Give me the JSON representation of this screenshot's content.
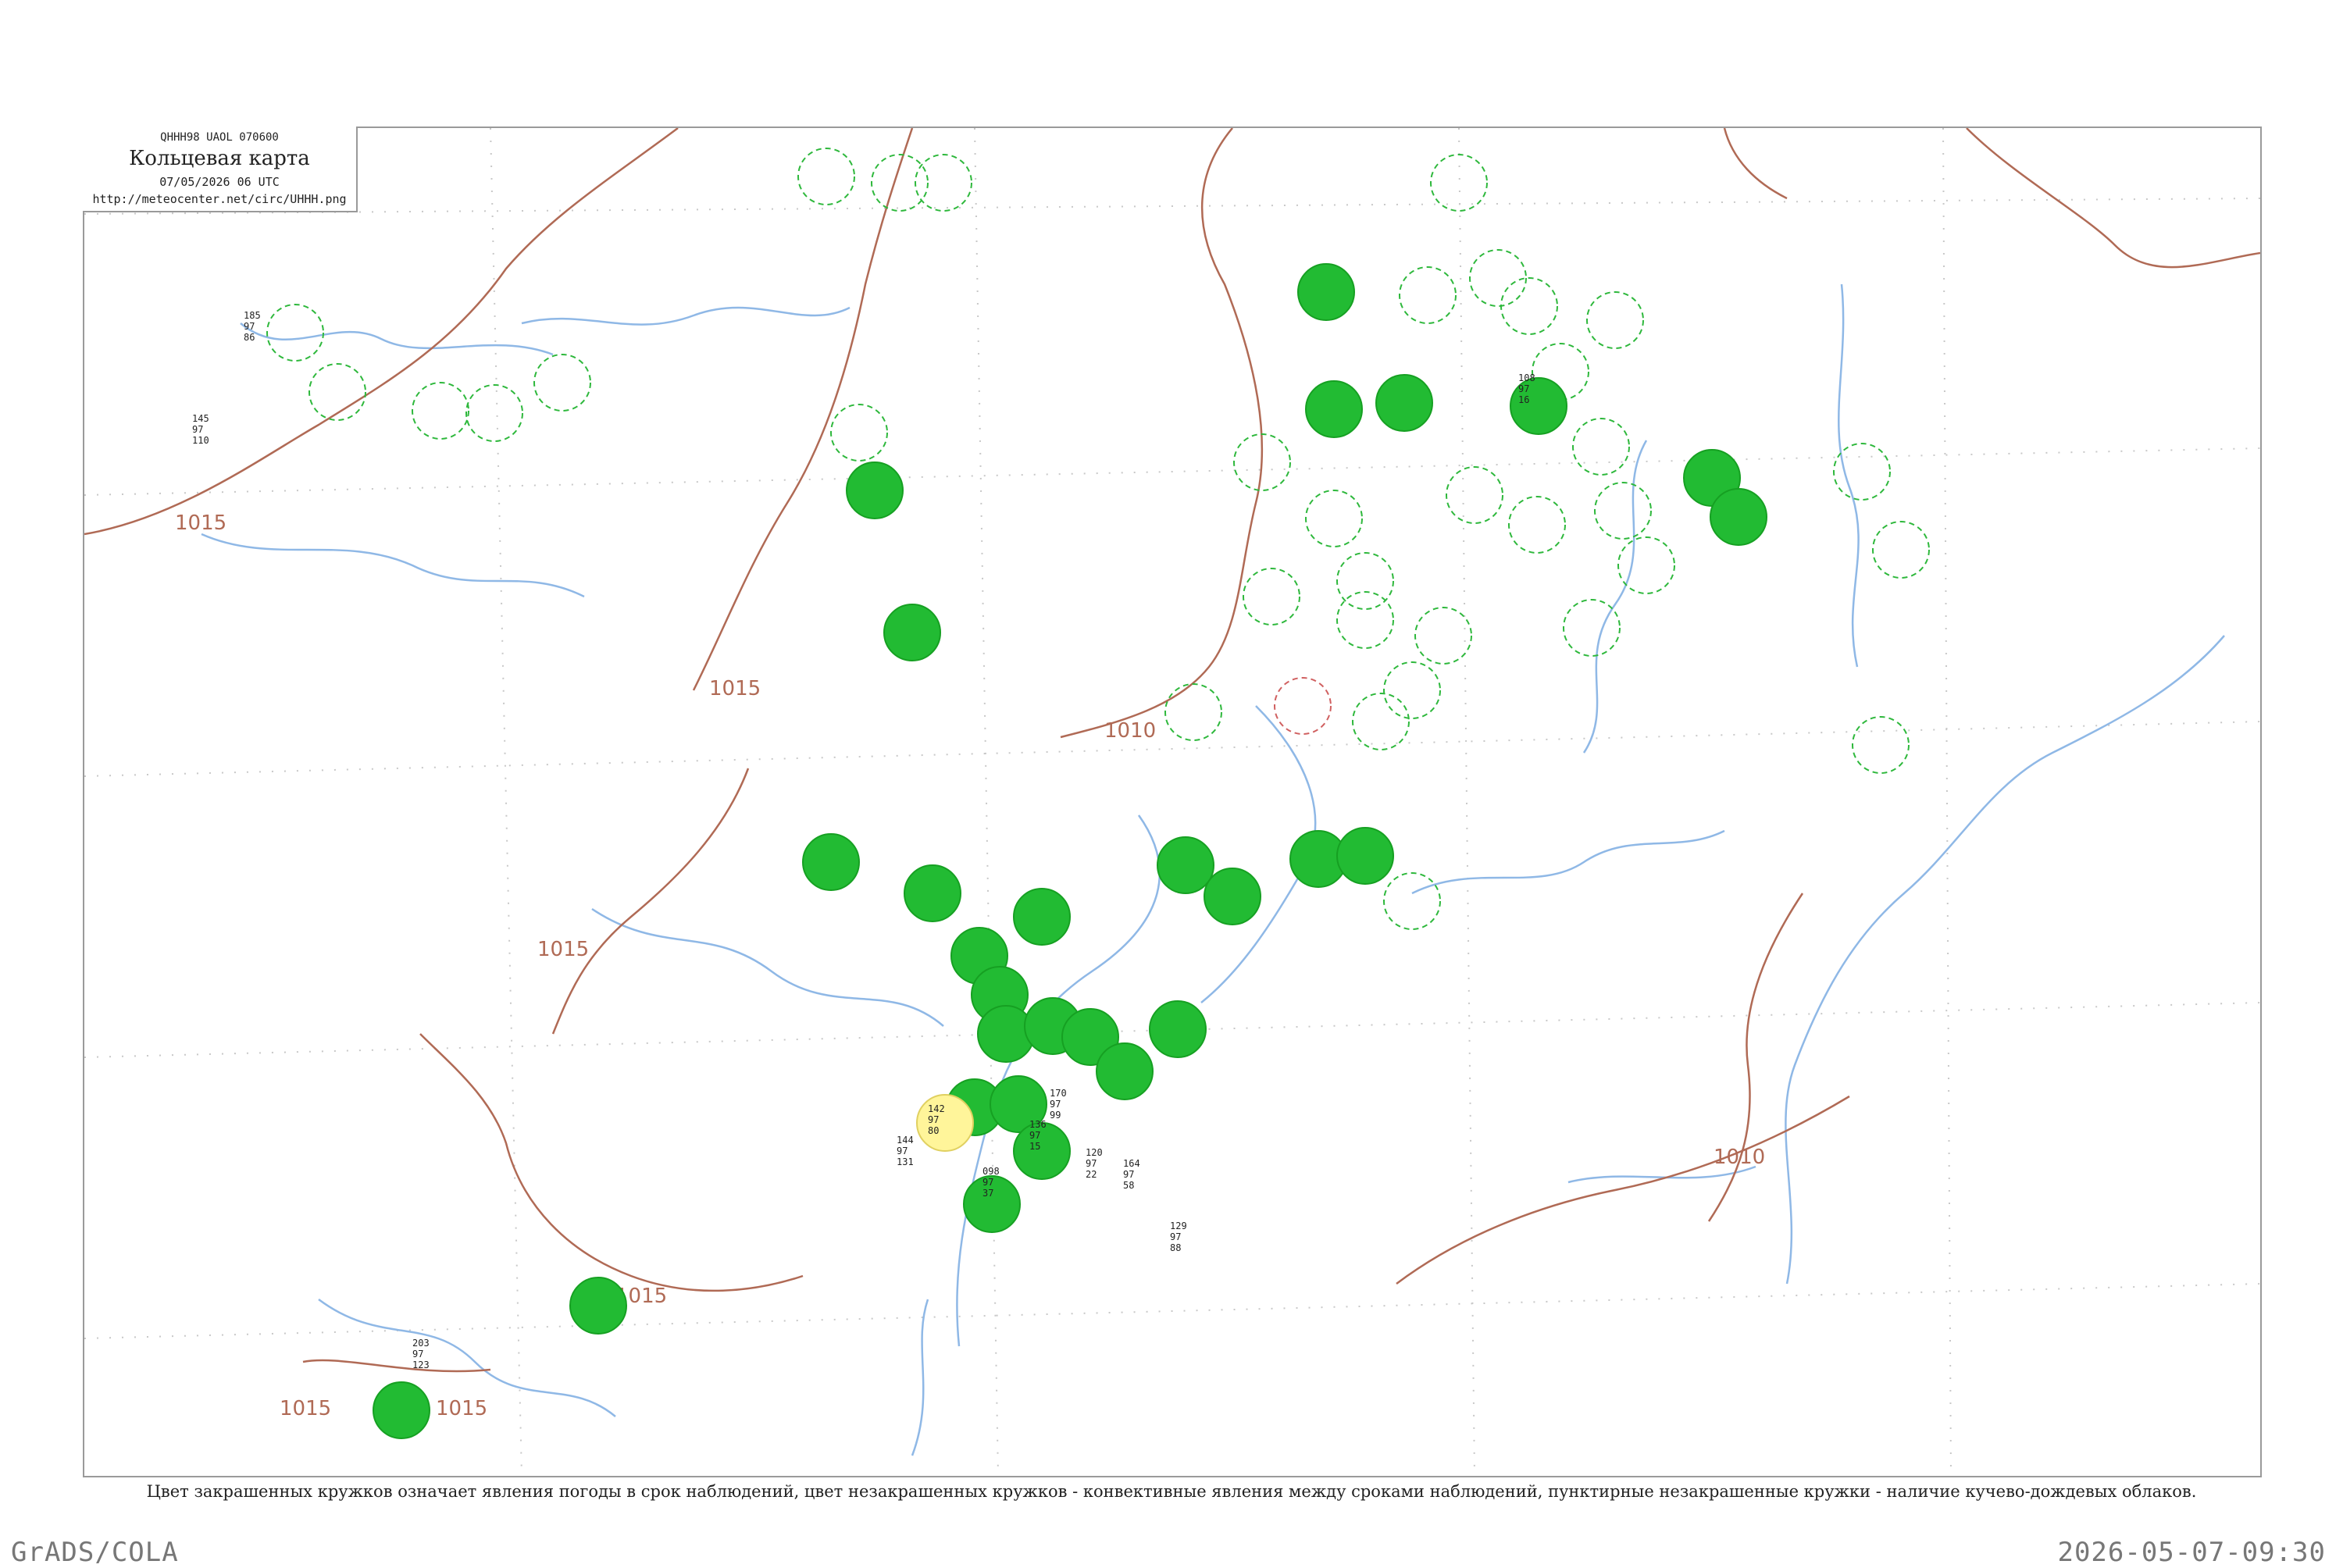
{
  "header": {
    "code": "QHHH98  UAOL  070600",
    "title": "Кольцевая карта",
    "time": "07/05/2026 06 UTC",
    "url": "http://meteocenter.net/circ/UHHH.png"
  },
  "caption": "Цвет закрашенных кружков означает явления погоды в срок наблюдений, цвет незакрашенных кружков - конвективные явления между сроками наблюдений, пунктирные незакрашенные кружки - наличие кучево-дождевых облаков.",
  "footer": {
    "left": "GrADS/COLA",
    "right": "2026-05-07-09:30"
  },
  "isobars": [
    {
      "label": "1015"
    },
    {
      "label": "1015"
    },
    {
      "label": "1010"
    },
    {
      "label": "1015"
    },
    {
      "label": "1015"
    },
    {
      "label": "1015"
    },
    {
      "label": "1015"
    },
    {
      "label": "1010"
    }
  ],
  "stations": [
    {
      "temp": "142",
      "p": "97",
      "d": "80"
    },
    {
      "temp": "136",
      "p": "97",
      "d": "15"
    },
    {
      "temp": "120",
      "p": "97",
      "d": "22"
    },
    {
      "temp": "164",
      "p": "97",
      "d": "58"
    },
    {
      "temp": "098",
      "p": "97",
      "d": "37"
    },
    {
      "temp": "129",
      "p": "97",
      "d": "88"
    },
    {
      "temp": "170",
      "p": "97",
      "d": "99"
    },
    {
      "temp": "144",
      "p": "97",
      "d": "131"
    },
    {
      "temp": "203",
      "p": "97",
      "d": "123"
    },
    {
      "temp": "185",
      "p": "97",
      "d": "86"
    },
    {
      "temp": "145",
      "p": "97",
      "d": "110"
    },
    {
      "temp": "108",
      "p": "97",
      "d": "16"
    }
  ],
  "colors": {
    "weather_fill": "#22bb33",
    "weather_stroke": "#16a022",
    "dashed_ring": "#2eb83c",
    "highlight_fill": "#fff59a",
    "isobar": "#b06a55",
    "river": "#8fb8e6",
    "frame": "#9a9a9a"
  }
}
